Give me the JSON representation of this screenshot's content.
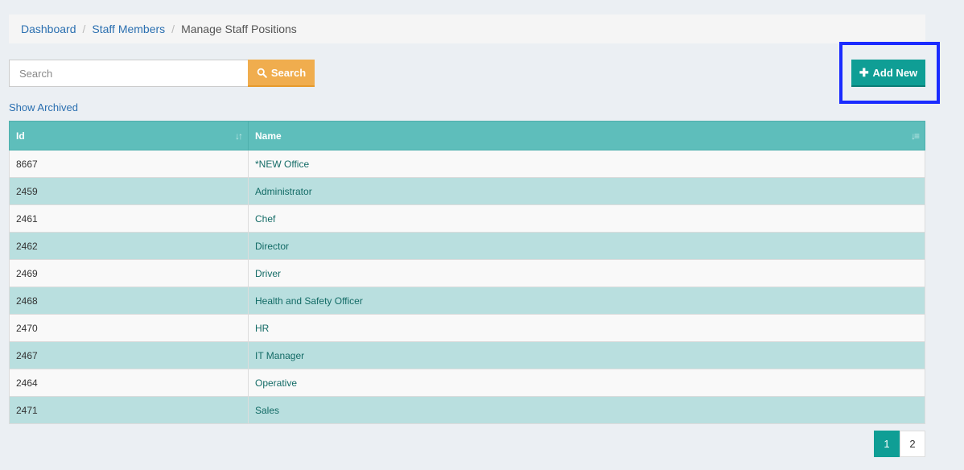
{
  "breadcrumb": {
    "items": [
      "Dashboard",
      "Staff Members"
    ],
    "current": "Manage Staff Positions"
  },
  "search": {
    "placeholder": "Search",
    "button_label": "Search"
  },
  "actions": {
    "add_new_label": "Add New",
    "show_archived_label": "Show Archived"
  },
  "table": {
    "columns": [
      "Id",
      "Name"
    ],
    "rows": [
      {
        "id": "8667",
        "name": "*NEW Office"
      },
      {
        "id": "2459",
        "name": "Administrator"
      },
      {
        "id": "2461",
        "name": "Chef"
      },
      {
        "id": "2462",
        "name": "Director"
      },
      {
        "id": "2469",
        "name": "Driver"
      },
      {
        "id": "2468",
        "name": "Health and Safety Officer"
      },
      {
        "id": "2470",
        "name": "HR"
      },
      {
        "id": "2467",
        "name": "IT Manager"
      },
      {
        "id": "2464",
        "name": "Operative"
      },
      {
        "id": "2471",
        "name": "Sales"
      }
    ]
  },
  "pagination": {
    "pages": [
      "1",
      "2"
    ],
    "current": "1"
  },
  "colors": {
    "accent": "#0f9e95",
    "search_button": "#f0ad4e",
    "header": "#5ebebb",
    "highlight": "#1a2bff"
  }
}
